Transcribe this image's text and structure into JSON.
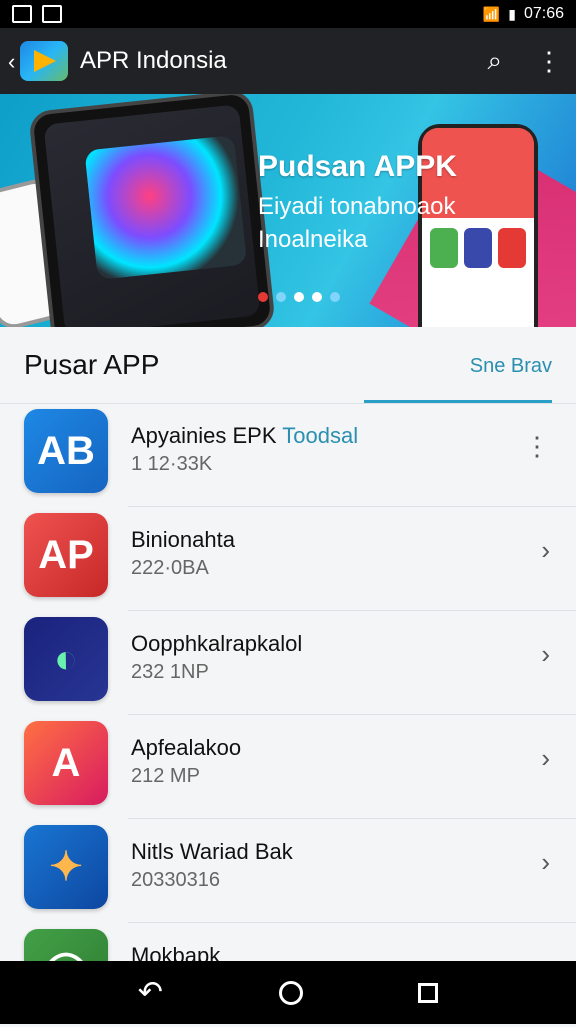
{
  "status_bar": {
    "time": "07:66"
  },
  "app_bar": {
    "back_glyph": "‹",
    "title": "APR Indonsia",
    "search_glyph": "⌕",
    "more_glyph": "⋮"
  },
  "banner": {
    "title": "Pudsan APPK",
    "subtitle": "Eiyadi tonabnoaok Inoalneika"
  },
  "section": {
    "title": "Pusar APP",
    "see_more": "Sne Brav"
  },
  "apps": [
    {
      "name": "Apyainies EPK ",
      "name_accent": "Toodsal",
      "meta": "1 12·33K",
      "action": "⋮",
      "icon_letter": "AB",
      "icon_colors": [
        "#1e88e5",
        "#1565c0"
      ]
    },
    {
      "name": "Binionahta",
      "name_accent": "",
      "meta": "222·0BA",
      "action": "›",
      "icon_letter": "AP",
      "icon_colors": [
        "#ef5350",
        "#c62828"
      ]
    },
    {
      "name": "Oopphkalrapkalol",
      "name_accent": "",
      "meta": "232 1NP",
      "action": "›",
      "icon_letter": "◐",
      "icon_colors": [
        "#1a237e",
        "#283593"
      ]
    },
    {
      "name": "Apfealakoo",
      "name_accent": "",
      "meta": "212 MP",
      "action": "›",
      "icon_letter": "A",
      "icon_colors": [
        "#ff7043",
        "#d81b60"
      ]
    },
    {
      "name": "Nitls Wariad Bak",
      "name_accent": "",
      "meta": "20330316",
      "action": "›",
      "icon_letter": "✦",
      "icon_colors": [
        "#1976d2",
        "#0d47a1"
      ]
    },
    {
      "name": "Mokbapk",
      "name_accent": "",
      "meta": "",
      "action": "",
      "icon_letter": "◯",
      "icon_colors": [
        "#43a047",
        "#2e7d32"
      ]
    }
  ],
  "nav_bar": {
    "back_glyph": "↶"
  }
}
